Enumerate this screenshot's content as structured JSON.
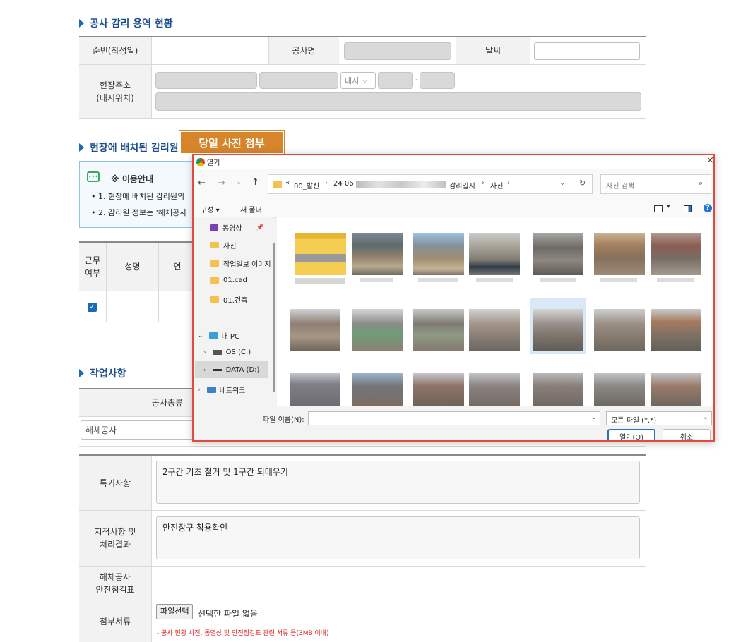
{
  "section1": {
    "title": "공사 감리 용역 현황",
    "row1": {
      "order_label": "순번(작성일)",
      "project_label": "공사명",
      "weather_label": "날씨"
    },
    "row2": {
      "address_label_1": "현장주소",
      "address_label_2": "(대지위치)",
      "lot_select": "대지",
      "dash": "-"
    }
  },
  "section2": {
    "title": "현장에 배치된 감리원",
    "notice_title": "※ 이용안내",
    "notice_1": "• 1. 현장에 배치된 감리원의",
    "notice_2": "• 2. 감리원 정보는 '해체공사",
    "table_headers": {
      "work_1": "근무",
      "work_2": "여부",
      "name": "성명",
      "partial": "연"
    }
  },
  "callout": {
    "label": "당일 사진 첨부"
  },
  "section3": {
    "title": "작업사항",
    "type_header": "공사종류",
    "type_value": "해체공사"
  },
  "special": {
    "label": "특기사항",
    "value": "2구간 기초 철거 및 1구간 되메우기"
  },
  "remarks": {
    "label_1": "지적사항 및",
    "label_2": "처리결과",
    "value": "안전장구 착용확인"
  },
  "safety": {
    "label_1": "해체공사",
    "label_2": "안전점검표"
  },
  "attach": {
    "label": "첨부서류",
    "file_button": "파일선택",
    "no_file": "선택한 파일 없음",
    "note": "- 공사 현황 사진, 동영상 및 안전점검표 관련 서류 등(3MB 이내)"
  },
  "dialog": {
    "title": "열기",
    "close": "×",
    "path_prefix": "«",
    "path_1": "00_발신",
    "path_2": "24 06",
    "path_3": "감리일지",
    "path_4": "사진",
    "search_placeholder": "사진 검색",
    "organize": "구성 ▾",
    "new_folder": "새 폴더",
    "nav": {
      "video": "동영상",
      "photos": "사진",
      "worklog": "작업일보 이미지",
      "cad": "01.cad",
      "building": "01.건축",
      "mypc": "내 PC",
      "os": "OS (C:)",
      "data": "DATA (D:)",
      "network": "네트워크"
    },
    "filename_label": "파일 이름(N):",
    "filetype": "모든 파일 (*.*)",
    "open_button": "열기(O)",
    "cancel_button": "취소"
  }
}
